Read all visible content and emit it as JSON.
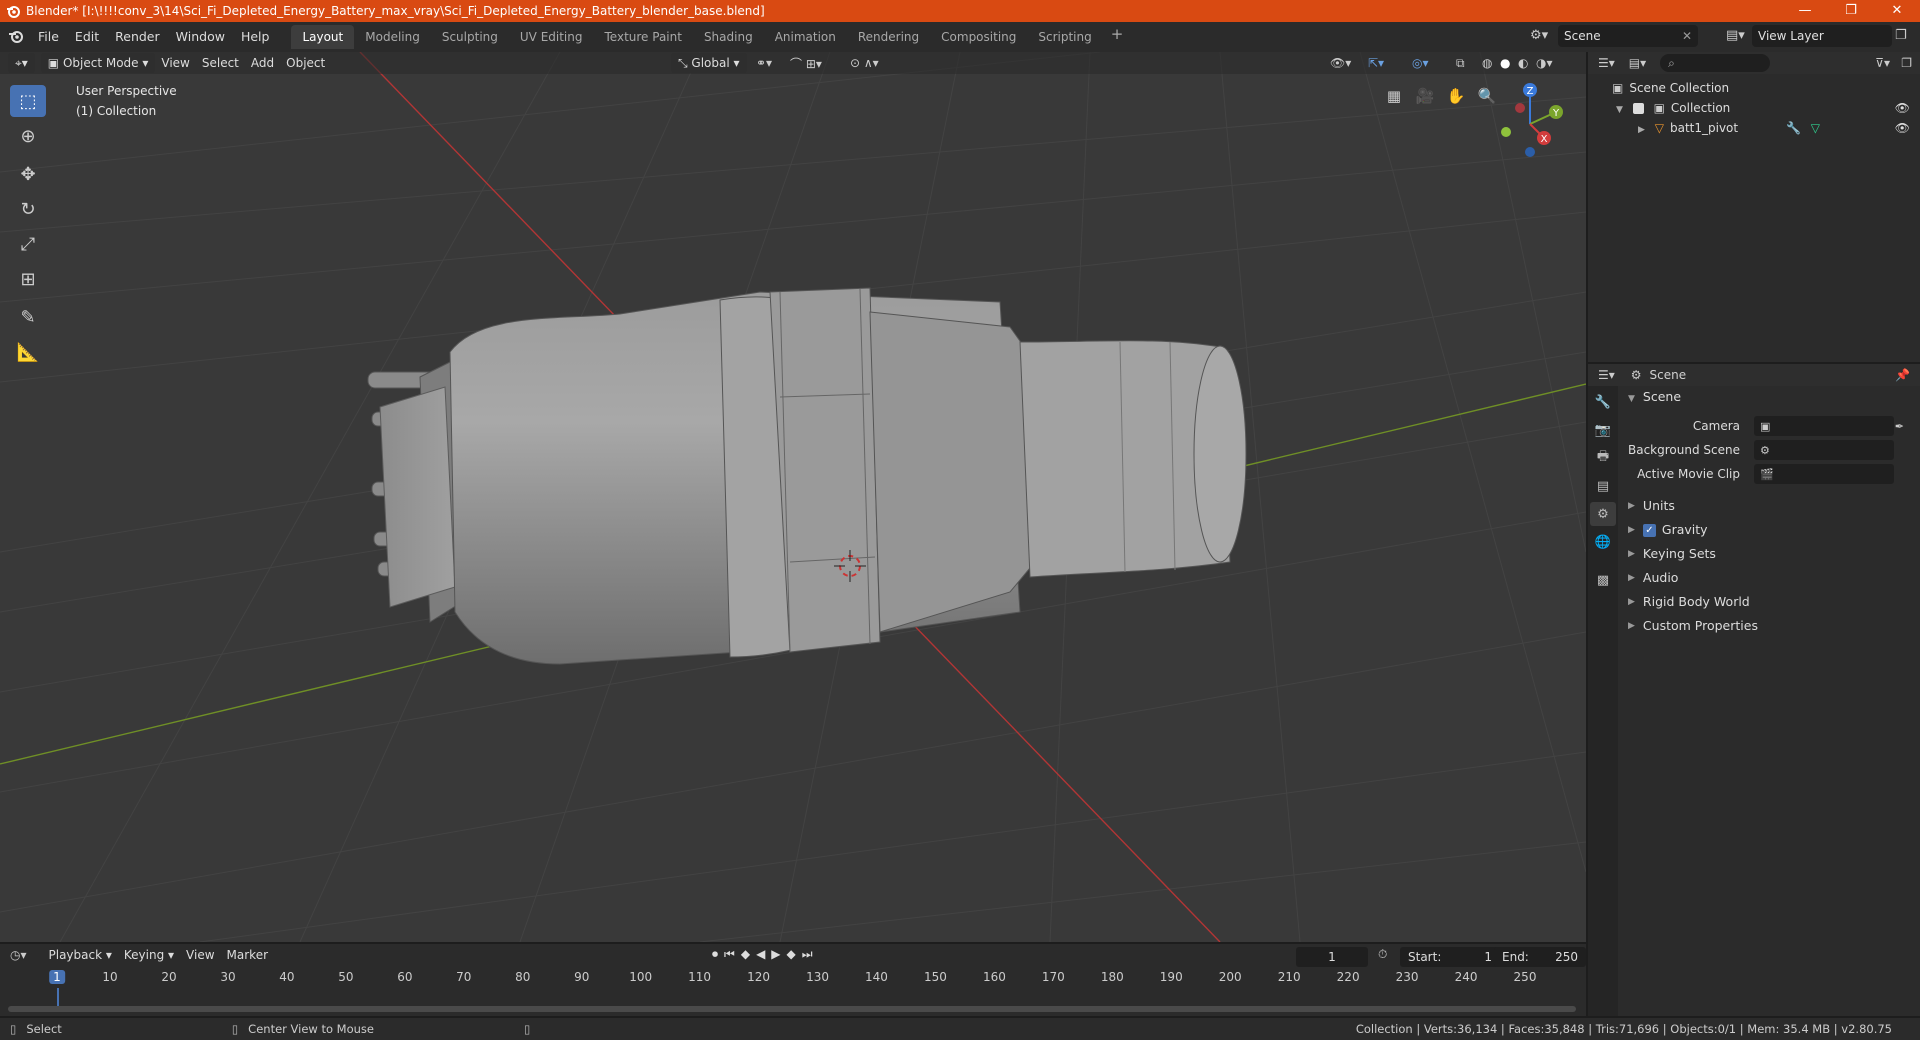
{
  "window": {
    "title": "Blender* [I:\\!!!!conv_3\\14\\Sci_Fi_Depleted_Energy_Battery_max_vray\\Sci_Fi_Depleted_Energy_Battery_blender_base.blend]",
    "minimize": "—",
    "restore": "❐",
    "close": "✕"
  },
  "menu": [
    "File",
    "Edit",
    "Render",
    "Window",
    "Help"
  ],
  "workspaces": [
    "Layout",
    "Modeling",
    "Sculpting",
    "UV Editing",
    "Texture Paint",
    "Shading",
    "Animation",
    "Rendering",
    "Compositing",
    "Scripting"
  ],
  "active_workspace": "Layout",
  "scene_name": "Scene",
  "view_layer": "View Layer",
  "viewport": {
    "mode": "Object Mode",
    "menus": [
      "View",
      "Select",
      "Add",
      "Object"
    ],
    "transform_orientation": "Global",
    "perspective_label": "User Perspective",
    "collection_label": "(1) Collection",
    "gizmo": {
      "x": "X",
      "y": "Y",
      "z": "Z"
    }
  },
  "outliner": {
    "root": "Scene Collection",
    "collection": "Collection",
    "object": "batt1_pivot"
  },
  "properties": {
    "header": "Scene",
    "panel": "Scene",
    "camera_label": "Camera",
    "background_scene_label": "Background Scene",
    "movie_clip_label": "Active Movie Clip",
    "subpanels": [
      "Units",
      "Gravity",
      "Keying Sets",
      "Audio",
      "Rigid Body World",
      "Custom Properties"
    ]
  },
  "timeline": {
    "menus": [
      "Playback",
      "Keying",
      "View",
      "Marker"
    ],
    "current_frame": "1",
    "start_label": "Start:",
    "start": "1",
    "end_label": "End:",
    "end": "250",
    "ticks": [
      "1",
      "10",
      "20",
      "30",
      "40",
      "50",
      "60",
      "70",
      "80",
      "90",
      "100",
      "110",
      "120",
      "130",
      "140",
      "150",
      "160",
      "170",
      "180",
      "190",
      "200",
      "210",
      "220",
      "230",
      "240",
      "250"
    ]
  },
  "status": {
    "select": "Select",
    "center_view": "Center View to Mouse",
    "stats": "Collection | Verts:36,134 | Faces:35,848 | Tris:71,696 | Objects:0/1 | Mem: 35.4 MB | v2.80.75"
  },
  "colors": {
    "title_bar": "#d94a12",
    "accent": "#4772b3",
    "x_axis": "#c23b3b",
    "y_axis": "#6e8f24"
  }
}
